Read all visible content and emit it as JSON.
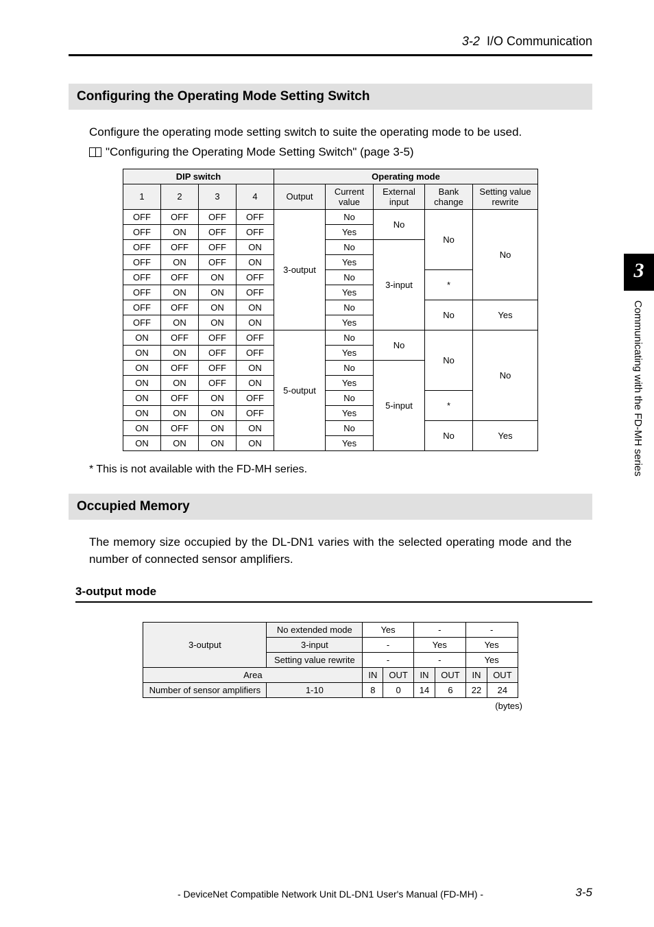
{
  "running_head": {
    "num": "3-2",
    "title": "I/O Communication"
  },
  "side_tab": {
    "num": "3",
    "label": "Communicating with the FD-MH series"
  },
  "h2_a": "Configuring the Operating Mode Setting Switch",
  "para_a": "Configure the operating mode setting switch to suite the operating mode to be used.",
  "xref_a": "\"Configuring the Operating Mode Setting Switch\" (page 3-5)",
  "dip": {
    "head_left": "DIP switch",
    "head_right": "Operating mode",
    "sub": {
      "c1": "1",
      "c2": "2",
      "c3": "3",
      "c4": "4",
      "out": "Output",
      "cv": "Current value",
      "ext": "External input",
      "bank": "Bank change",
      "svr": "Setting value rewrite"
    },
    "rows": [
      {
        "d1": "OFF",
        "d2": "OFF",
        "d3": "OFF",
        "d4": "OFF",
        "cv": "No"
      },
      {
        "d1": "OFF",
        "d2": "ON",
        "d3": "OFF",
        "d4": "OFF",
        "cv": "Yes"
      },
      {
        "d1": "OFF",
        "d2": "OFF",
        "d3": "OFF",
        "d4": "ON",
        "cv": "No"
      },
      {
        "d1": "OFF",
        "d2": "ON",
        "d3": "OFF",
        "d4": "ON",
        "cv": "Yes"
      },
      {
        "d1": "OFF",
        "d2": "OFF",
        "d3": "ON",
        "d4": "OFF",
        "cv": "No"
      },
      {
        "d1": "OFF",
        "d2": "ON",
        "d3": "ON",
        "d4": "OFF",
        "cv": "Yes"
      },
      {
        "d1": "OFF",
        "d2": "OFF",
        "d3": "ON",
        "d4": "ON",
        "cv": "No"
      },
      {
        "d1": "OFF",
        "d2": "ON",
        "d3": "ON",
        "d4": "ON",
        "cv": "Yes"
      },
      {
        "d1": "ON",
        "d2": "OFF",
        "d3": "OFF",
        "d4": "OFF",
        "cv": "No"
      },
      {
        "d1": "ON",
        "d2": "ON",
        "d3": "OFF",
        "d4": "OFF",
        "cv": "Yes"
      },
      {
        "d1": "ON",
        "d2": "OFF",
        "d3": "OFF",
        "d4": "ON",
        "cv": "No"
      },
      {
        "d1": "ON",
        "d2": "ON",
        "d3": "OFF",
        "d4": "ON",
        "cv": "Yes"
      },
      {
        "d1": "ON",
        "d2": "OFF",
        "d3": "ON",
        "d4": "OFF",
        "cv": "No"
      },
      {
        "d1": "ON",
        "d2": "ON",
        "d3": "ON",
        "d4": "OFF",
        "cv": "Yes"
      },
      {
        "d1": "ON",
        "d2": "OFF",
        "d3": "ON",
        "d4": "ON",
        "cv": "No"
      },
      {
        "d1": "ON",
        "d2": "ON",
        "d3": "ON",
        "d4": "ON",
        "cv": "Yes"
      }
    ],
    "output_vals": {
      "top": "3-output",
      "bot": "5-output"
    },
    "ext_vals": {
      "a": "No",
      "b": "3-input",
      "c": "No",
      "d": "5-input"
    },
    "bank_vals": {
      "a": "No",
      "b": "*",
      "c": "No",
      "d": "No",
      "e": "*",
      "f": "No"
    },
    "svr_vals": {
      "a": "No",
      "b": "Yes",
      "c": "No",
      "d": "Yes"
    }
  },
  "footnote": "*   This is not available with the FD-MH series.",
  "h2_b": "Occupied Memory",
  "para_b": "The memory size occupied by the DL-DN1 varies with the selected operating mode and the number of connected sensor amplifiers.",
  "h3_a": "3-output mode",
  "mem": {
    "row_label": "3-output",
    "r1": {
      "label": "No extended mode",
      "v1": "Yes",
      "v2": "-",
      "v3": "-"
    },
    "r2": {
      "label": "3-input",
      "v1": "-",
      "v2": "Yes",
      "v3": "Yes"
    },
    "r3": {
      "label": "Setting value rewrite",
      "v1": "-",
      "v2": "-",
      "v3": "Yes"
    },
    "area": "Area",
    "io": {
      "in": "IN",
      "out": "OUT"
    },
    "amp_label": "Number of sensor amplifiers",
    "amp_range": "1-10",
    "vals": [
      "8",
      "0",
      "14",
      "6",
      "22",
      "24"
    ],
    "bytes": "(bytes)"
  },
  "footer": {
    "text": "- DeviceNet Compatible Network Unit DL-DN1 User's Manual (FD-MH) -",
    "page": "3-5"
  }
}
